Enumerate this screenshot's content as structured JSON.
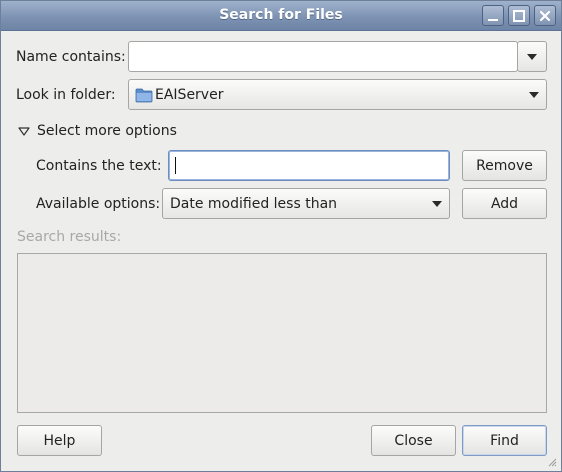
{
  "window": {
    "title": "Search for Files"
  },
  "wm": {
    "minimize_icon": "minimize-icon",
    "maximize_icon": "maximize-icon",
    "close_icon": "close-icon"
  },
  "form": {
    "name_label": "Name contains:",
    "name_value": "",
    "folder_label": "Look in folder:",
    "folder_value": "EAIServer",
    "folder_icon": "folder-icon",
    "expander_label": "Select more options",
    "expander_expanded": true
  },
  "options": {
    "contains_label": "Contains the text:",
    "contains_value": "",
    "remove_label": "Remove",
    "available_label": "Available options:",
    "available_value": "Date modified less than",
    "add_label": "Add"
  },
  "results": {
    "label": "Search results:"
  },
  "footer": {
    "help_label": "Help",
    "close_label": "Close",
    "find_label": "Find"
  },
  "colors": {
    "titlebar": "#7e93b3",
    "window_bg": "#ededeb",
    "focus_border": "#6c8dc3",
    "disabled_text": "#a8a8a6"
  }
}
